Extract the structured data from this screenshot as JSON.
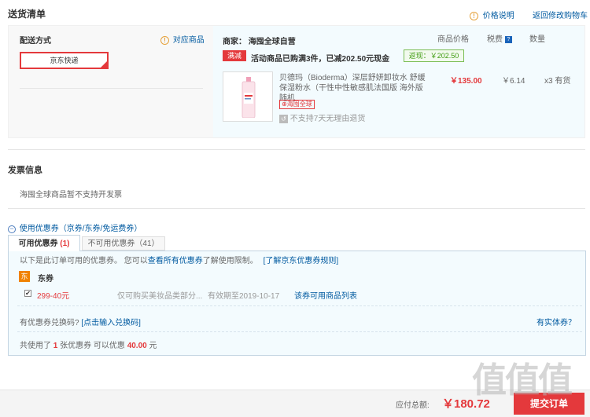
{
  "header": {
    "title": "送货清单",
    "price_note": "价格说明",
    "back_to_cart": "返回修改购物车"
  },
  "shipping": {
    "method_label": "配送方式",
    "match_goods": "对应商品",
    "express_option": "京东快递",
    "merchant_label": "商家：",
    "merchant_name": "海囤全球自营",
    "col_price": "商品价格",
    "col_tax": "税费",
    "col_qty": "数量",
    "promo_tag": "满减",
    "promo_text": "活动商品已购满3件，已减202.50元现金",
    "rebate": "返现：￥202.50",
    "product_name": "贝德玛（Bioderma）深层舒妍卸妆水 舒缓保湿粉水（干性中性敏感肌法国版 海外版随机",
    "product_price": "￥135.00",
    "product_tax": "￥6.14",
    "product_qty": "x3 有货",
    "global_tag": "海囤全球",
    "no_return": "不支持7天无理由退货"
  },
  "invoice": {
    "title": "发票信息",
    "note": "海囤全球商品暂不支持开发票"
  },
  "coupons": {
    "toggle_label": "使用优惠券（京券/东券/免运费券）",
    "tab_available_label": "可用优惠券",
    "tab_available_count": "(1)",
    "tab_unavailable": "不可用优惠券（41）",
    "info_prefix": "以下是此订单可用的优惠券。 您可以",
    "info_link": "查看所有优惠券",
    "info_suffix": "了解使用限制。",
    "rules_link": "[了解京东优惠券规则]",
    "dong_badge": "东",
    "dong_title": "东券",
    "coupon_amount": "299-40元",
    "coupon_scope": "仅可购买美妆品类部分...",
    "coupon_expiry": "有效期至2019-10-17",
    "coupon_goods_link": "该券可用商品列表",
    "redeem_prompt": "有优惠券兑换码?",
    "redeem_link": "[点击输入兑换码]",
    "physical_link": "有实体券？",
    "summary_prefix": "共使用了",
    "summary_count": "1",
    "summary_mid": "张优惠券   可以优惠",
    "summary_amount": "40.00",
    "summary_unit": "元"
  },
  "footer": {
    "total_label": "应付总额:",
    "total_amount": "￥180.72",
    "submit_label": "提交订单",
    "watermark": "值 什么值得买"
  }
}
